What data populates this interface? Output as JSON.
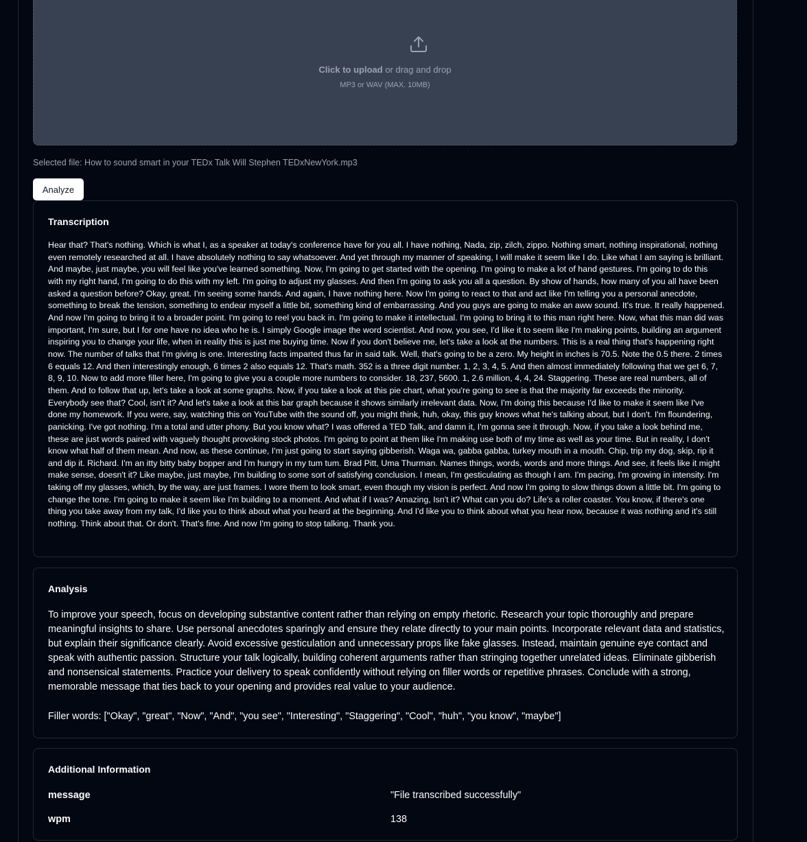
{
  "upload": {
    "icon": "upload-icon",
    "click_label": "Click to upload",
    "drag_label": " or drag and drop",
    "hint": "MP3 or WAV (MAX. 10MB)"
  },
  "selected_file": "Selected file: How to sound smart in your TEDx Talk Will Stephen TEDxNewYork.mp3",
  "analyze_button": "Analyze",
  "transcription": {
    "title": "Transcription",
    "text": "Hear that? That's nothing. Which is what I, as a speaker at today's conference have for you all. I have nothing, Nada, zip, zilch, zippo. Nothing smart, nothing inspirational, nothing even remotely researched at all. I have absolutely nothing to say whatsoever. And yet through my manner of speaking, I will make it seem like I do. Like what I am saying is brilliant. And maybe, just maybe, you will feel like you've learned something. Now, I'm going to get started with the opening. I'm going to make a lot of hand gestures. I'm going to do this with my right hand, I'm going to do this with my left. I'm going to adjust my glasses. And then I'm going to ask you all a question. By show of hands, how many of you all have been asked a question before? Okay, great. I'm seeing some hands. And again, I have nothing here. Now I'm going to react to that and act like I'm telling you a personal anecdote, something to break the tension, something to endear myself a little bit, something kind of embarrassing. And you guys are going to make an aww sound. It's true. It really happened. And now I'm going to bring it to a broader point. I'm going to reel you back in. I'm going to make it intellectual. I'm going to bring it to this man right here. Now, what this man did was important, I'm sure, but I for one have no idea who he is. I simply Google image the word scientist. And now, you see, I'd like it to seem like I'm making points, building an argument inspiring you to change your life, when in reality this is just me buying time. Now if you don't believe me, let's take a look at the numbers. This is a real thing that's happening right now. The number of talks that I'm giving is one. Interesting facts imparted thus far in said talk. Well, that's going to be a zero. My height in inches is 70.5. Note the 0.5 there. 2 times 6 equals 12. And then interestingly enough, 6 times 2 also equals 12. That's math. 352 is a three digit number. 1, 2, 3, 4, 5. And then almost immediately following that we get 6, 7, 8, 9, 10. Now to add more filler here, I'm going to give you a couple more numbers to consider. 18, 237, 5600. 1, 2.6 million, 4, 4, 24. Staggering. These are real numbers, all of them. And to follow that up, let's take a look at some graphs. Now, if you take a look at this pie chart, what you're going to see is that the majority far exceeds the minority. Everybody see that? Cool, isn't it? And let's take a look at this bar graph because it shows similarly irrelevant data. Now, I'm doing this because I'd like to make it seem like I've done my homework. If you were, say, watching this on YouTube with the sound off, you might think, huh, okay, this guy knows what he's talking about, but I don't. I'm floundering, panicking. I've got nothing. I'm a total and utter phony. But you know what? I was offered a TED Talk, and damn it, I'm gonna see it through. Now, if you take a look behind me, these are just words paired with vaguely thought provoking stock photos. I'm going to point at them like I'm making use both of my time as well as your time. But in reality, I don't know what half of them mean. And now, as these continue, I'm just going to start saying gibberish. Waga wa, gabba gabba, turkey mouth in a mouth. Chip, trip my dog, skip, rip it and dip it. Richard. I'm an itty bitty baby bopper and I'm hungry in my tum tum. Brad Pitt, Uma Thurman. Names things, words, words and more things. And see, it feels like it might make sense, doesn't it? Like maybe, just maybe, I'm building to some sort of satisfying conclusion. I mean, I'm gesticulating as though I am. I'm pacing, I'm growing in intensity. I'm taking off my glasses, which, by the way, are just frames. I wore them to look smart, even though my vision is perfect. And now I'm going to slow things down a little bit. I'm going to change the tone. I'm going to make it seem like I'm building to a moment. And what if I was? Amazing, Isn't it? What can you do? Life's a roller coaster. You know, if there's one thing you take away from my talk, I'd like you to think about what you heard at the beginning. And I'd like you to think about what you hear now, because it was nothing and it's still nothing. Think about that. Or don't. That's fine. And now I'm going to stop talking. Thank you."
  },
  "analysis": {
    "title": "Analysis",
    "text": "To improve your speech, focus on developing substantive content rather than relying on empty rhetoric. Research your topic thoroughly and prepare meaningful insights to share. Use personal anecdotes sparingly and ensure they relate directly to your main points. Incorporate relevant data and statistics, but explain their significance clearly. Avoid excessive gesticulation and unnecessary props like fake glasses. Instead, maintain genuine eye contact and speak with authentic passion. Structure your talk logically, building coherent arguments rather than stringing together unrelated ideas. Eliminate gibberish and nonsensical statements. Practice your delivery to speak confidently without relying on filler words or repetitive phrases. Conclude with a strong, memorable message that ties back to your opening and provides real value to your audience.",
    "filler_words": "Filler words: [\"Okay\", \"great\", \"Now\", \"And\", \"you see\", \"Interesting\", \"Staggering\", \"Cool\", \"huh\", \"you know\", \"maybe\"]"
  },
  "additional_info": {
    "title": "Additional Information",
    "rows": [
      {
        "key": "message",
        "value": "\"File transcribed successfully\""
      },
      {
        "key": "wpm",
        "value": "138"
      }
    ]
  }
}
